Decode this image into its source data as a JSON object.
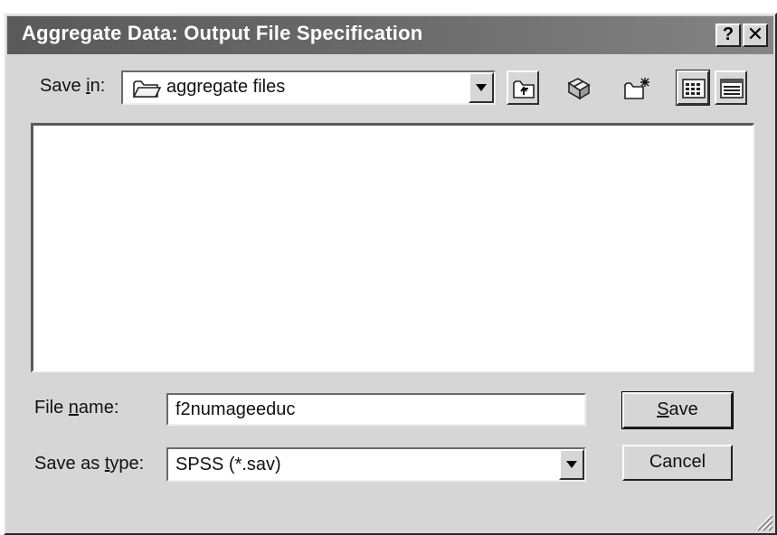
{
  "window": {
    "title": "Aggregate Data: Output File Specification",
    "help_label": "?",
    "close_label": "✕"
  },
  "toolbar": {
    "save_in_prefix": "Save ",
    "save_in_hotkey": "i",
    "save_in_suffix": "n:",
    "save_in_value": "aggregate files",
    "buttons": [
      "up-one-level",
      "desktop",
      "create-new-folder",
      "list-view",
      "details-view"
    ]
  },
  "form": {
    "file_name_prefix": "File ",
    "file_name_hotkey": "n",
    "file_name_suffix": "ame:",
    "file_name_value": "f2numageeduc",
    "save_as_type_prefix": "Save as ",
    "save_as_type_hotkey": "t",
    "save_as_type_suffix": "ype:",
    "save_as_type_value": "SPSS (*.sav)"
  },
  "buttons": {
    "save_hotkey": "S",
    "save_rest": "ave",
    "cancel_label": "Cancel"
  },
  "colors": {
    "title_bar": "#5a5a5a",
    "dialog_face": "#d6d6d6",
    "list_background": "#ffffff"
  }
}
